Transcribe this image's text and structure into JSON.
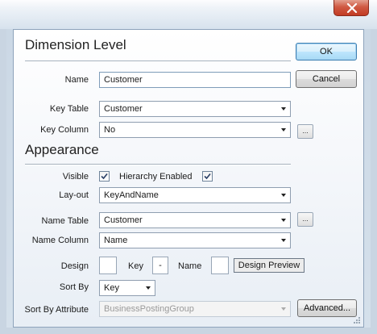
{
  "dialog": {
    "close_icon": "close-icon",
    "section_dimension": "Dimension Level",
    "section_appearance": "Appearance",
    "ok_label": "OK",
    "cancel_label": "Cancel",
    "advanced_label": "Advanced...",
    "ellipsis_label": "...",
    "accent": "#3c7fb1",
    "close_color": "#c94a32"
  },
  "fields": {
    "name": {
      "label": "Name",
      "value": "Customer"
    },
    "key_table": {
      "label": "Key Table",
      "value": "Customer"
    },
    "key_column": {
      "label": "Key Column",
      "value": "No"
    },
    "visible": {
      "label": "Visible",
      "checked": true
    },
    "hierarchy_enabled": {
      "label": "Hierarchy Enabled",
      "checked": true
    },
    "layout": {
      "label": "Lay-out",
      "value": "KeyAndName"
    },
    "name_table": {
      "label": "Name Table",
      "value": "Customer"
    },
    "name_column": {
      "label": "Name Column",
      "value": "Name"
    },
    "design": {
      "label": "Design",
      "key_label": "Key",
      "separator": "-",
      "name_label": "Name",
      "preview_label": "Design Preview"
    },
    "sort_by": {
      "label": "Sort By",
      "value": "Key"
    },
    "sort_by_attribute": {
      "label": "Sort By Attribute",
      "value": "BusinessPostingGroup",
      "disabled": true
    }
  }
}
